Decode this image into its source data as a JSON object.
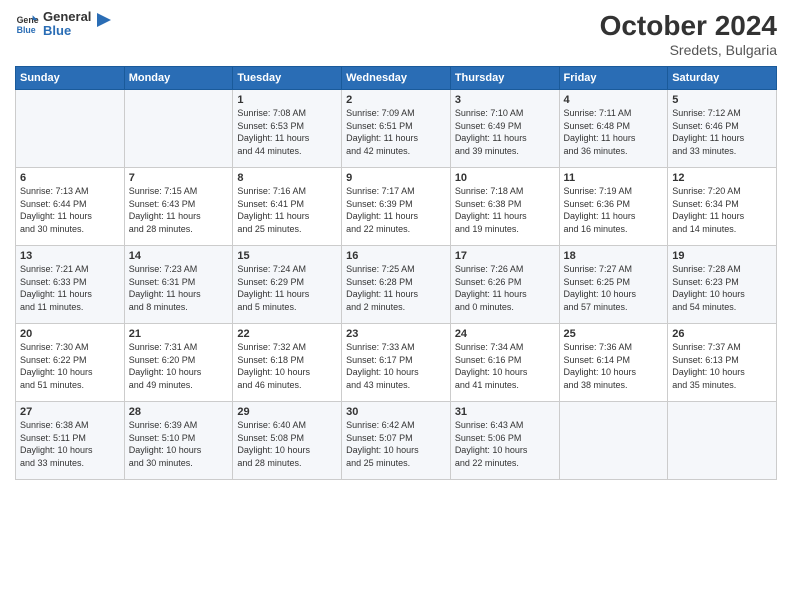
{
  "header": {
    "logo_general": "General",
    "logo_blue": "Blue",
    "title": "October 2024",
    "location": "Sredets, Bulgaria"
  },
  "weekdays": [
    "Sunday",
    "Monday",
    "Tuesday",
    "Wednesday",
    "Thursday",
    "Friday",
    "Saturday"
  ],
  "rows": [
    [
      {
        "day": "",
        "info": ""
      },
      {
        "day": "",
        "info": ""
      },
      {
        "day": "1",
        "info": "Sunrise: 7:08 AM\nSunset: 6:53 PM\nDaylight: 11 hours\nand 44 minutes."
      },
      {
        "day": "2",
        "info": "Sunrise: 7:09 AM\nSunset: 6:51 PM\nDaylight: 11 hours\nand 42 minutes."
      },
      {
        "day": "3",
        "info": "Sunrise: 7:10 AM\nSunset: 6:49 PM\nDaylight: 11 hours\nand 39 minutes."
      },
      {
        "day": "4",
        "info": "Sunrise: 7:11 AM\nSunset: 6:48 PM\nDaylight: 11 hours\nand 36 minutes."
      },
      {
        "day": "5",
        "info": "Sunrise: 7:12 AM\nSunset: 6:46 PM\nDaylight: 11 hours\nand 33 minutes."
      }
    ],
    [
      {
        "day": "6",
        "info": "Sunrise: 7:13 AM\nSunset: 6:44 PM\nDaylight: 11 hours\nand 30 minutes."
      },
      {
        "day": "7",
        "info": "Sunrise: 7:15 AM\nSunset: 6:43 PM\nDaylight: 11 hours\nand 28 minutes."
      },
      {
        "day": "8",
        "info": "Sunrise: 7:16 AM\nSunset: 6:41 PM\nDaylight: 11 hours\nand 25 minutes."
      },
      {
        "day": "9",
        "info": "Sunrise: 7:17 AM\nSunset: 6:39 PM\nDaylight: 11 hours\nand 22 minutes."
      },
      {
        "day": "10",
        "info": "Sunrise: 7:18 AM\nSunset: 6:38 PM\nDaylight: 11 hours\nand 19 minutes."
      },
      {
        "day": "11",
        "info": "Sunrise: 7:19 AM\nSunset: 6:36 PM\nDaylight: 11 hours\nand 16 minutes."
      },
      {
        "day": "12",
        "info": "Sunrise: 7:20 AM\nSunset: 6:34 PM\nDaylight: 11 hours\nand 14 minutes."
      }
    ],
    [
      {
        "day": "13",
        "info": "Sunrise: 7:21 AM\nSunset: 6:33 PM\nDaylight: 11 hours\nand 11 minutes."
      },
      {
        "day": "14",
        "info": "Sunrise: 7:23 AM\nSunset: 6:31 PM\nDaylight: 11 hours\nand 8 minutes."
      },
      {
        "day": "15",
        "info": "Sunrise: 7:24 AM\nSunset: 6:29 PM\nDaylight: 11 hours\nand 5 minutes."
      },
      {
        "day": "16",
        "info": "Sunrise: 7:25 AM\nSunset: 6:28 PM\nDaylight: 11 hours\nand 2 minutes."
      },
      {
        "day": "17",
        "info": "Sunrise: 7:26 AM\nSunset: 6:26 PM\nDaylight: 11 hours\nand 0 minutes."
      },
      {
        "day": "18",
        "info": "Sunrise: 7:27 AM\nSunset: 6:25 PM\nDaylight: 10 hours\nand 57 minutes."
      },
      {
        "day": "19",
        "info": "Sunrise: 7:28 AM\nSunset: 6:23 PM\nDaylight: 10 hours\nand 54 minutes."
      }
    ],
    [
      {
        "day": "20",
        "info": "Sunrise: 7:30 AM\nSunset: 6:22 PM\nDaylight: 10 hours\nand 51 minutes."
      },
      {
        "day": "21",
        "info": "Sunrise: 7:31 AM\nSunset: 6:20 PM\nDaylight: 10 hours\nand 49 minutes."
      },
      {
        "day": "22",
        "info": "Sunrise: 7:32 AM\nSunset: 6:18 PM\nDaylight: 10 hours\nand 46 minutes."
      },
      {
        "day": "23",
        "info": "Sunrise: 7:33 AM\nSunset: 6:17 PM\nDaylight: 10 hours\nand 43 minutes."
      },
      {
        "day": "24",
        "info": "Sunrise: 7:34 AM\nSunset: 6:16 PM\nDaylight: 10 hours\nand 41 minutes."
      },
      {
        "day": "25",
        "info": "Sunrise: 7:36 AM\nSunset: 6:14 PM\nDaylight: 10 hours\nand 38 minutes."
      },
      {
        "day": "26",
        "info": "Sunrise: 7:37 AM\nSunset: 6:13 PM\nDaylight: 10 hours\nand 35 minutes."
      }
    ],
    [
      {
        "day": "27",
        "info": "Sunrise: 6:38 AM\nSunset: 5:11 PM\nDaylight: 10 hours\nand 33 minutes."
      },
      {
        "day": "28",
        "info": "Sunrise: 6:39 AM\nSunset: 5:10 PM\nDaylight: 10 hours\nand 30 minutes."
      },
      {
        "day": "29",
        "info": "Sunrise: 6:40 AM\nSunset: 5:08 PM\nDaylight: 10 hours\nand 28 minutes."
      },
      {
        "day": "30",
        "info": "Sunrise: 6:42 AM\nSunset: 5:07 PM\nDaylight: 10 hours\nand 25 minutes."
      },
      {
        "day": "31",
        "info": "Sunrise: 6:43 AM\nSunset: 5:06 PM\nDaylight: 10 hours\nand 22 minutes."
      },
      {
        "day": "",
        "info": ""
      },
      {
        "day": "",
        "info": ""
      }
    ]
  ]
}
